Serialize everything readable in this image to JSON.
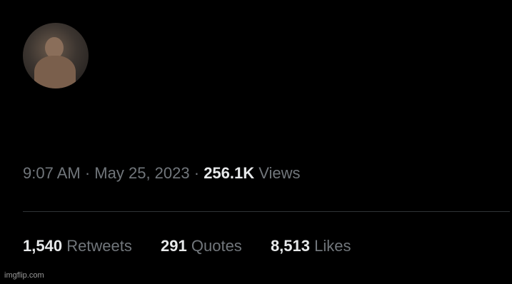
{
  "author": {
    "display_name": "",
    "handle": "",
    "avatar_icon": "profile-photo-avatar"
  },
  "tweet": {
    "text": ""
  },
  "meta": {
    "time": "9:07 AM",
    "separator": "·",
    "date": "May 25, 2023",
    "views_count": "256.1K",
    "views_label": "Views"
  },
  "stats": {
    "retweets_count": "1,540",
    "retweets_label": "Retweets",
    "quotes_count": "291",
    "quotes_label": "Quotes",
    "likes_count": "8,513",
    "likes_label": "Likes"
  },
  "watermark": "imgflip.com",
  "colors": {
    "background": "#000000",
    "primary_text": "#e7e9ea",
    "secondary_text": "#71767b",
    "divider": "#2f3336"
  }
}
